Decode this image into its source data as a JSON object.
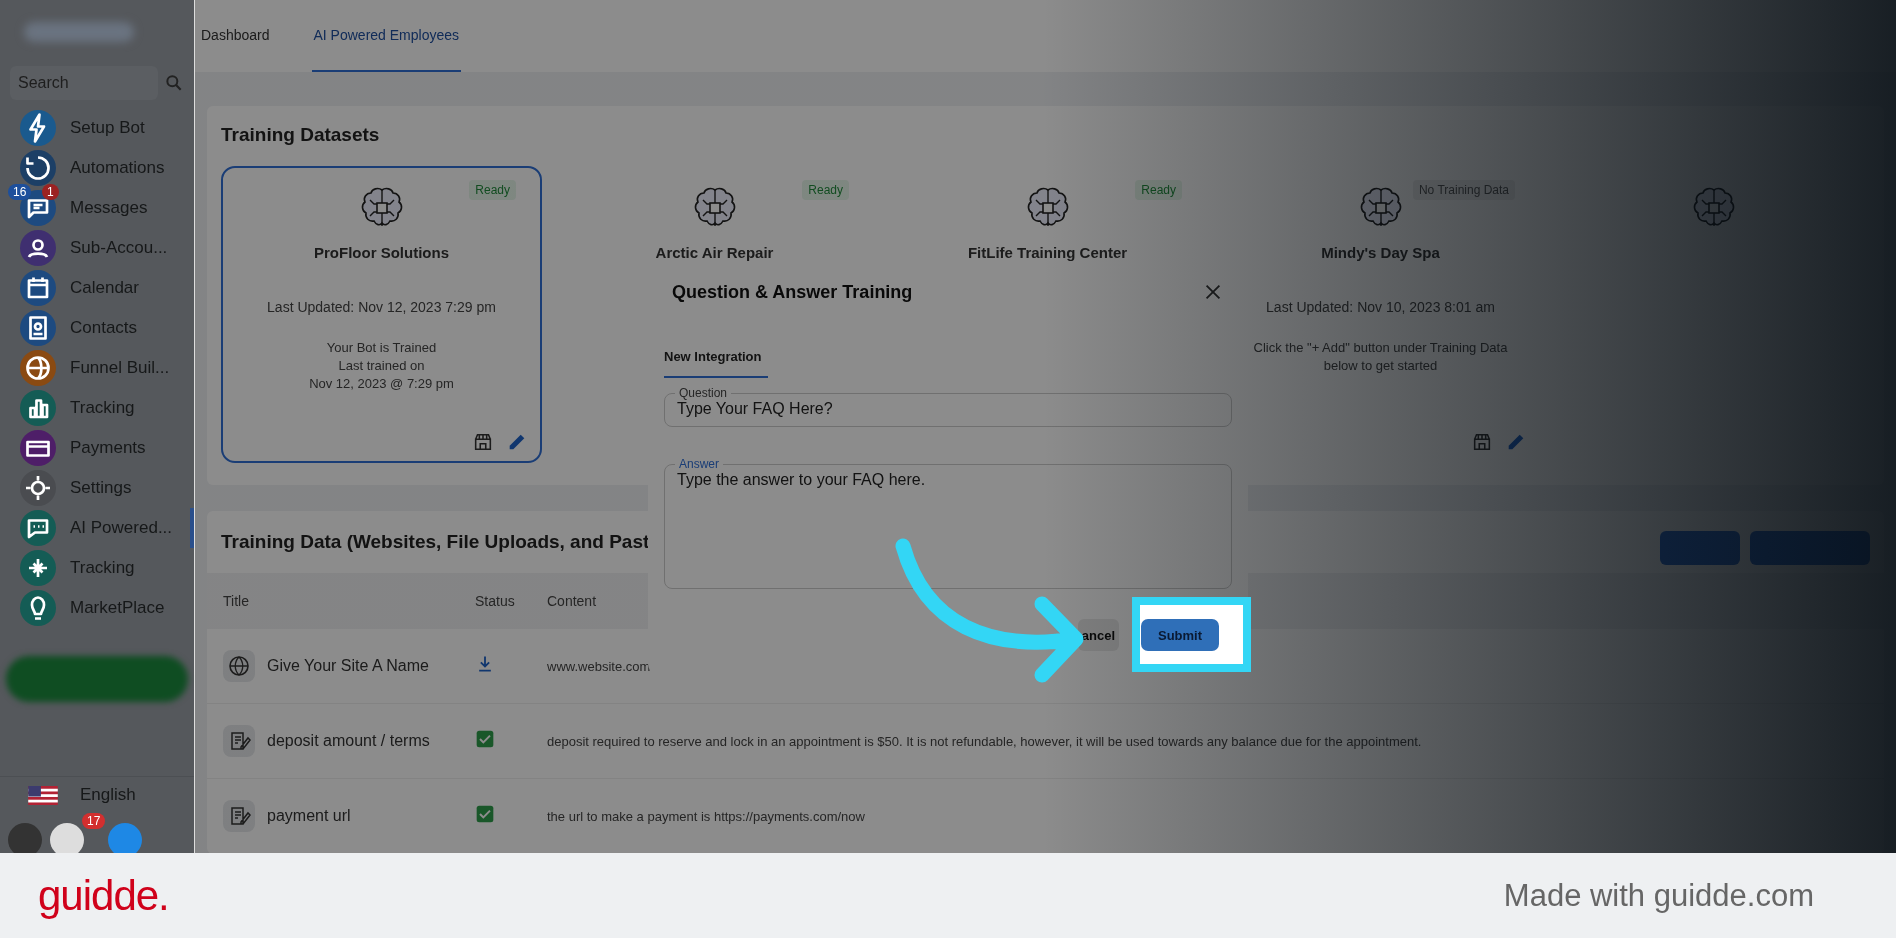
{
  "sidebar": {
    "search": {
      "placeholder": "Search"
    },
    "items": [
      {
        "label": "Setup Bot",
        "color": "#1a5a8e",
        "selected": false
      },
      {
        "label": "Automations",
        "color": "#1c3f66",
        "selected": false
      },
      {
        "label": "Messages",
        "color": "#1d4a80",
        "selected": false,
        "badges": [
          {
            "text": "16",
            "color": "#1d4f9c"
          },
          {
            "text": "1",
            "color": "#9c2222"
          }
        ]
      },
      {
        "label": "Sub-Accou...",
        "color": "#3f2f70",
        "selected": false
      },
      {
        "label": "Calendar",
        "color": "#1d4a80",
        "selected": false
      },
      {
        "label": "Contacts",
        "color": "#1d4a80",
        "selected": false
      },
      {
        "label": "Funnel Buil...",
        "color": "#8a4a12",
        "selected": false
      },
      {
        "label": "Tracking",
        "color": "#145c55",
        "selected": false
      },
      {
        "label": "Payments",
        "color": "#4e1e68",
        "selected": false
      },
      {
        "label": "Settings",
        "color": "#4a4c50",
        "selected": false
      },
      {
        "label": "AI Powered...",
        "color": "#145c55",
        "selected": true
      },
      {
        "label": "Tracking",
        "color": "#145c55",
        "selected": false
      },
      {
        "label": "MarketPlace",
        "color": "#145c55",
        "selected": false
      }
    ],
    "language": "English",
    "notification_count": "17"
  },
  "tabs": [
    {
      "label": "Dashboard",
      "selected": false
    },
    {
      "label": "AI Powered Employees",
      "selected": true
    }
  ],
  "datasets": {
    "title": "Training Datasets",
    "cards": [
      {
        "name": "ProFloor Solutions",
        "status": "Ready",
        "ready": true,
        "selected": true,
        "updated": "Last Updated: Nov 12, 2023 7:29 pm",
        "lines": [
          "Your Bot is Trained",
          "Last trained on",
          "Nov 12, 2023 @ 7:29 pm"
        ]
      },
      {
        "name": "Arctic Air Repair",
        "status": "Ready",
        "ready": true,
        "selected": false
      },
      {
        "name": "FitLife Training Center",
        "status": "Ready",
        "ready": true,
        "selected": false
      },
      {
        "name": "Mindy's Day Spa",
        "status": "No Training Data",
        "ready": false,
        "selected": false,
        "updated": "Last Updated: Nov 10, 2023 8:01 am",
        "lines": [
          "Click the \"+ Add\" button under Training Data",
          "below to get started"
        ]
      },
      {
        "selected": false
      }
    ]
  },
  "training_data": {
    "title": "Training Data (Websites, File Uploads, and Past",
    "columns": [
      "Title",
      "Status",
      "Content"
    ],
    "rows": [
      {
        "kind": "website",
        "title": "Give Your Site A Name",
        "content": "www.website.com"
      },
      {
        "kind": "text",
        "title": "deposit amount / terms",
        "content": "deposit required to reserve and lock in an appointment is $50. It is not refundable, however, it will be used towards any balance due for the appointment."
      },
      {
        "kind": "text",
        "title": "payment url",
        "content": "the url to make a payment is https://payments.com/now"
      }
    ]
  },
  "modal": {
    "title": "Question & Answer Training",
    "tab": "New Integration",
    "question": {
      "label": "Question",
      "value": "Type Your FAQ Here?"
    },
    "answer": {
      "label": "Answer",
      "value": "Type the answer to your FAQ here."
    },
    "cancel": "ancel",
    "submit": "Submit"
  },
  "footer": {
    "logo": "guidde.",
    "credit": "Made with guidde.com"
  }
}
